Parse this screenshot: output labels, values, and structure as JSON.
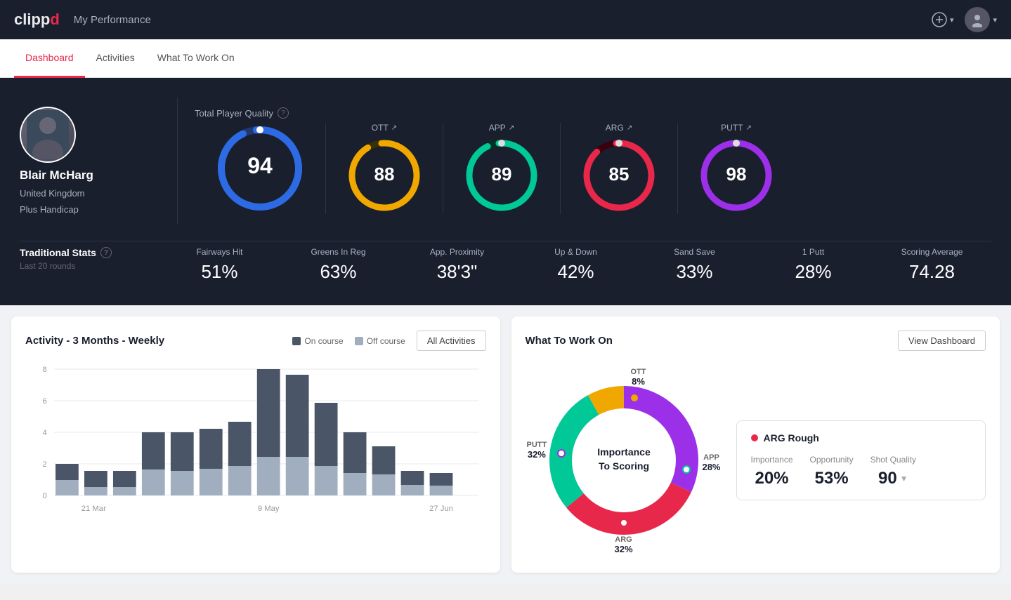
{
  "header": {
    "logo": "clippd",
    "logo_clip": "clipp",
    "logo_d": "d",
    "title": "My Performance",
    "add_btn_label": "⊕",
    "chevron": "▾"
  },
  "nav": {
    "tabs": [
      {
        "id": "dashboard",
        "label": "Dashboard",
        "active": true
      },
      {
        "id": "activities",
        "label": "Activities",
        "active": false
      },
      {
        "id": "what-to-work-on",
        "label": "What To Work On",
        "active": false
      }
    ]
  },
  "player": {
    "name": "Blair McHarg",
    "country": "United Kingdom",
    "handicap": "Plus Handicap"
  },
  "total_player_quality": {
    "label": "Total Player Quality",
    "value": 94,
    "gauges": [
      {
        "id": "ott",
        "label": "OTT",
        "value": 88,
        "color": "#f0a800",
        "track": "#3a3000"
      },
      {
        "id": "app",
        "label": "APP",
        "value": 89,
        "color": "#00c896",
        "track": "#003322"
      },
      {
        "id": "arg",
        "label": "ARG",
        "value": 85,
        "color": "#e8284b",
        "track": "#3a0010"
      },
      {
        "id": "putt",
        "label": "PUTT",
        "value": 98,
        "color": "#9b30e8",
        "track": "#2a0040"
      }
    ]
  },
  "traditional_stats": {
    "title": "Traditional Stats",
    "subtitle": "Last 20 rounds",
    "stats": [
      {
        "id": "fairways-hit",
        "label": "Fairways Hit",
        "value": "51%"
      },
      {
        "id": "greens-in-reg",
        "label": "Greens In Reg",
        "value": "63%"
      },
      {
        "id": "app-proximity",
        "label": "App. Proximity",
        "value": "38'3\""
      },
      {
        "id": "up-down",
        "label": "Up & Down",
        "value": "42%"
      },
      {
        "id": "sand-save",
        "label": "Sand Save",
        "value": "33%"
      },
      {
        "id": "one-putt",
        "label": "1 Putt",
        "value": "28%"
      },
      {
        "id": "scoring-average",
        "label": "Scoring Average",
        "value": "74.28"
      }
    ]
  },
  "activity_chart": {
    "title": "Activity - 3 Months - Weekly",
    "legend": [
      {
        "label": "On course",
        "color": "#4a5568"
      },
      {
        "label": "Off course",
        "color": "#a0aec0"
      }
    ],
    "all_activities_label": "All Activities",
    "x_labels": [
      "21 Mar",
      "9 May",
      "27 Jun"
    ],
    "y_labels": [
      "0",
      "2",
      "4",
      "6",
      "8"
    ],
    "bars": [
      {
        "on": 1,
        "off": 1
      },
      {
        "on": 1,
        "off": 0.5
      },
      {
        "on": 1,
        "off": 0.5
      },
      {
        "on": 2.5,
        "off": 1.5
      },
      {
        "on": 2,
        "off": 2
      },
      {
        "on": 2.5,
        "off": 1.5
      },
      {
        "on": 3,
        "off": 2
      },
      {
        "on": 6,
        "off": 2.5
      },
      {
        "on": 5.5,
        "off": 2.5
      },
      {
        "on": 4,
        "off": 1.5
      },
      {
        "on": 2.5,
        "off": 1
      },
      {
        "on": 1.5,
        "off": 1
      },
      {
        "on": 0.5,
        "off": 0.3
      },
      {
        "on": 0.5,
        "off": 0.2
      }
    ]
  },
  "what_to_work_on": {
    "title": "What To Work On",
    "view_dashboard_label": "View Dashboard",
    "donut": {
      "center_text": "Importance\nTo Scoring",
      "segments": [
        {
          "id": "ott",
          "label": "OTT",
          "pct": "8%",
          "value": 8,
          "color": "#f0a800"
        },
        {
          "id": "app",
          "label": "APP",
          "pct": "28%",
          "value": 28,
          "color": "#00c896"
        },
        {
          "id": "arg",
          "label": "ARG",
          "pct": "32%",
          "value": 32,
          "color": "#e8284b"
        },
        {
          "id": "putt",
          "label": "PUTT",
          "pct": "32%",
          "value": 32,
          "color": "#9b30e8"
        }
      ]
    },
    "selected_item": {
      "title": "ARG Rough",
      "dot_color": "#e8284b",
      "metrics": [
        {
          "label": "Importance",
          "value": "20%"
        },
        {
          "label": "Opportunity",
          "value": "53%"
        },
        {
          "label": "Shot Quality",
          "value": "90",
          "badge": "↓"
        }
      ]
    }
  }
}
